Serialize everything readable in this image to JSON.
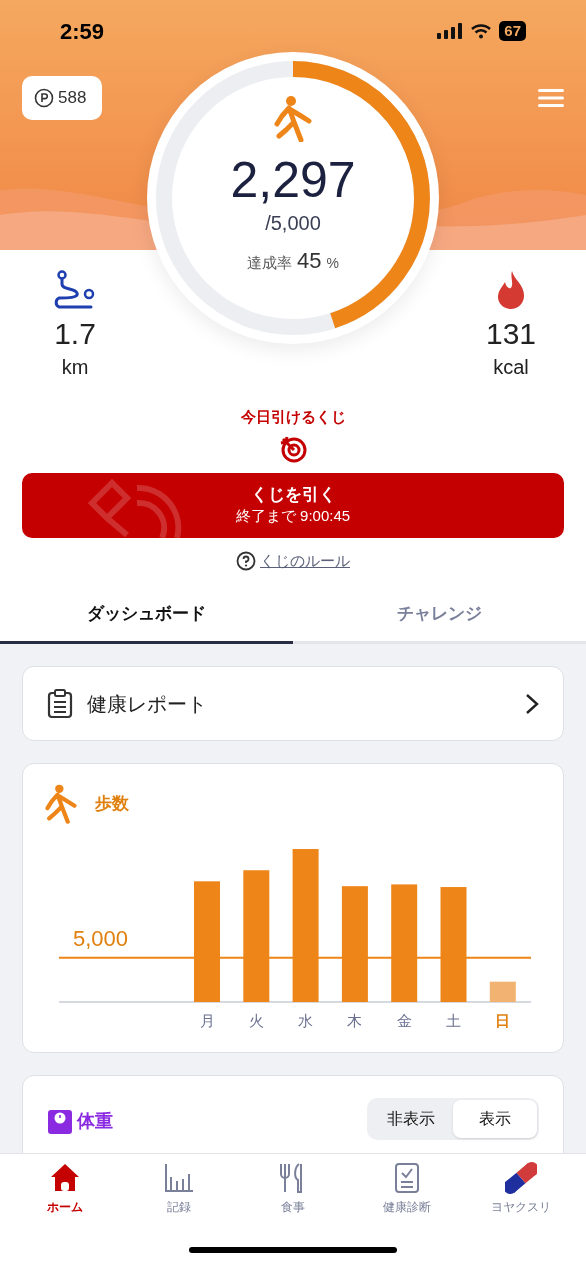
{
  "status_bar": {
    "time": "2:59",
    "battery": "67"
  },
  "points": {
    "value": "588"
  },
  "steps": {
    "count": "2,297",
    "goal": "/5,000",
    "rate_label": "達成率",
    "rate": "45",
    "rate_unit": "%",
    "level": 0.45
  },
  "distance": {
    "value": "1.7",
    "unit": "km"
  },
  "calories": {
    "value": "131",
    "unit": "kcal"
  },
  "lottery": {
    "title": "今日引けるくじ",
    "button_label": "くじを引く",
    "button_sub": "終了まで 9:00:45",
    "rules_link": "くじのルール"
  },
  "tabs": [
    {
      "label": "ダッシュボード",
      "selected": true
    },
    {
      "label": "チャレンジ",
      "selected": false
    }
  ],
  "report_card": {
    "title": "健康レポート"
  },
  "steps_card": {
    "title": "歩数",
    "goal_label": "5,000",
    "days": [
      {
        "label": "月",
        "selected": false
      },
      {
        "label": "火",
        "selected": false
      },
      {
        "label": "水",
        "selected": false
      },
      {
        "label": "木",
        "selected": false
      },
      {
        "label": "金",
        "selected": false
      },
      {
        "label": "土",
        "selected": false
      },
      {
        "label": "日",
        "selected": true
      }
    ]
  },
  "weight_card": {
    "title": "体重",
    "segments": [
      {
        "label": "非表示",
        "selected": false
      },
      {
        "label": "表示",
        "selected": true
      }
    ]
  },
  "nav": [
    {
      "kind": "home",
      "label": "ホーム",
      "selected": true
    },
    {
      "kind": "records",
      "label": "記録",
      "selected": false
    },
    {
      "kind": "meal",
      "label": "食事",
      "selected": false
    },
    {
      "kind": "checkup",
      "label": "健康診断",
      "selected": false
    },
    {
      "kind": "medicine",
      "label": "ヨヤクスリ",
      "selected": false
    }
  ]
}
